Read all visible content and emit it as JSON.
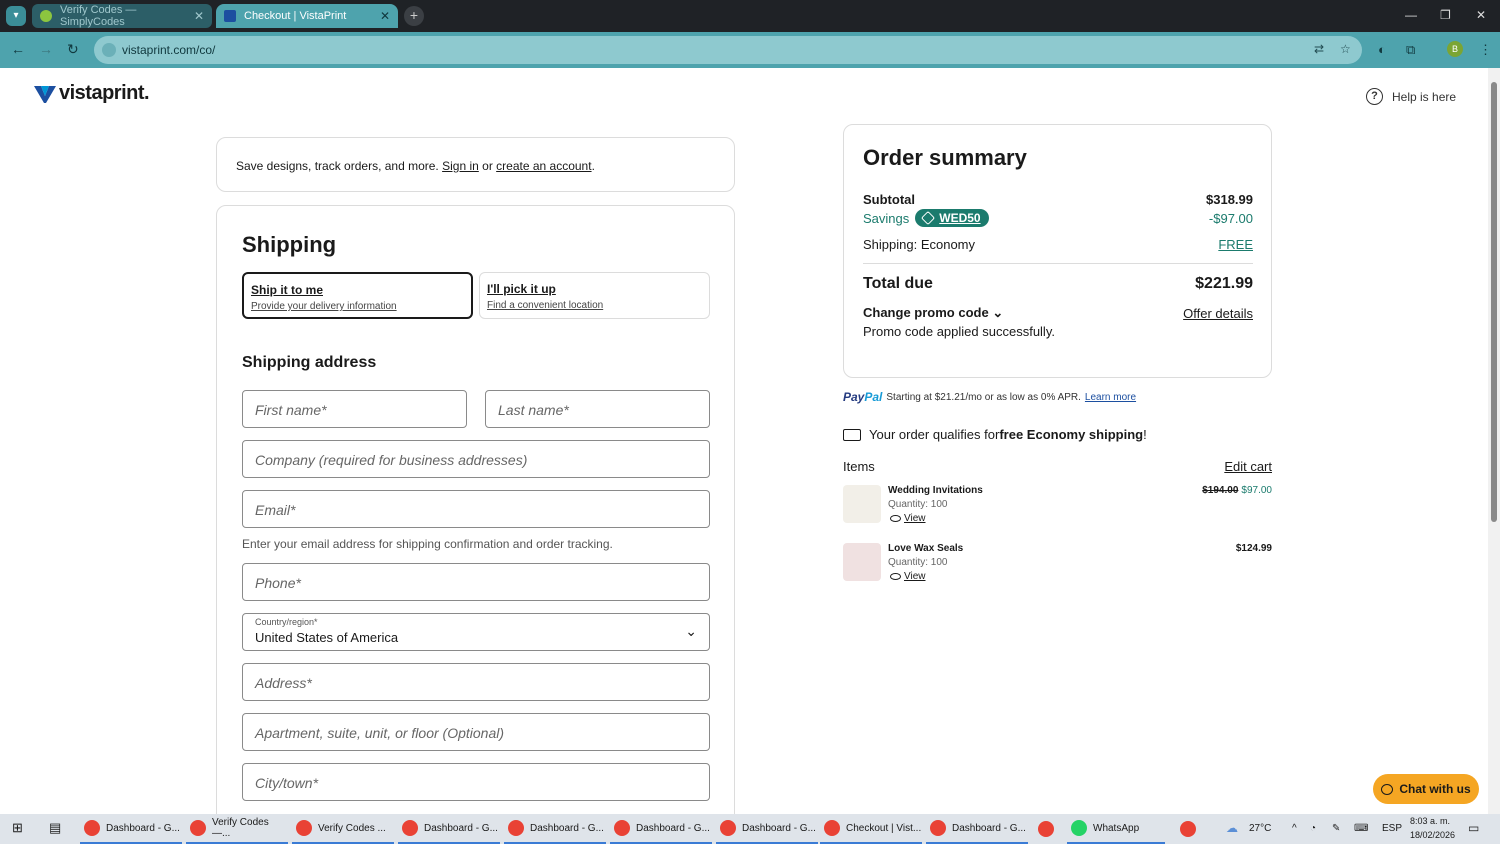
{
  "browser": {
    "tabs": [
      {
        "title": "Verify Codes — SimplyCodes",
        "active": false
      },
      {
        "title": "Checkout | VistaPrint",
        "active": true
      }
    ],
    "url": "vistaprint.com/co/",
    "profile_initial": "B"
  },
  "header": {
    "logo": "vistaprint.",
    "help": "Help is here"
  },
  "signin": {
    "text": "Save designs, track orders, and more. ",
    "sign_in": "Sign in",
    "or": " or ",
    "create": "create an account",
    "end": "."
  },
  "shipping": {
    "title": "Shipping",
    "options": [
      {
        "title": "Ship it to me",
        "subtitle": "Provide your delivery information",
        "selected": true
      },
      {
        "title": "I'll pick it up",
        "subtitle": "Find a convenient location",
        "selected": false
      }
    ],
    "address_title": "Shipping address",
    "fields": {
      "first_name": "First name*",
      "last_name": "Last name*",
      "company": "Company (required for business addresses)",
      "email": "Email*",
      "email_hint": "Enter your email address for shipping confirmation and order tracking.",
      "phone": "Phone*",
      "country_label": "Country/region*",
      "country_value": "United States of America",
      "address": "Address*",
      "apartment": "Apartment, suite, unit, or floor (Optional)",
      "city": "City/town*"
    }
  },
  "summary": {
    "title": "Order summary",
    "subtotal_label": "Subtotal",
    "subtotal": "$318.99",
    "savings_label": "Savings",
    "promo_code": "WED50",
    "savings": "-$97.00",
    "shipping_label": "Shipping: Economy",
    "shipping_value": "FREE",
    "total_label": "Total due",
    "total": "$221.99",
    "change_promo": "Change promo code",
    "offer_details": "Offer details",
    "promo_message": "Promo code applied successfully."
  },
  "paypal": {
    "brand_a": "Pay",
    "brand_b": "Pal",
    "text": "Starting at $21.21/mo or as low as 0% APR.",
    "link": "Learn more"
  },
  "free_shipping": {
    "prefix": "Your order qualifies for ",
    "bold": "free Economy shipping",
    "suffix": "!"
  },
  "items": {
    "title": "Items",
    "edit": "Edit cart",
    "list": [
      {
        "name": "Wedding Invitations",
        "quantity": "Quantity: 100",
        "view": "View",
        "old_price": "$194.00",
        "price": "$97.00"
      },
      {
        "name": "Love Wax Seals",
        "quantity": "Quantity: 100",
        "view": "View",
        "old_price": "",
        "price": "$124.99"
      }
    ]
  },
  "chat": "Chat with us",
  "taskbar": {
    "items": [
      "Dashboard - G...",
      "Verify Codes —...",
      "Verify Codes ...",
      "Dashboard - G...",
      "Dashboard - G...",
      "Dashboard - G...",
      "Dashboard - G...",
      "Checkout | Vist...",
      "Dashboard - G...",
      "WhatsApp"
    ],
    "weather": "27°C",
    "lang": "ESP",
    "time": "8:03 a. m.",
    "date": "18/02/2026"
  },
  "colors": {
    "accent": "#1b7b6d",
    "chrome": "#4ea3ad",
    "chat": "#f5a623"
  }
}
